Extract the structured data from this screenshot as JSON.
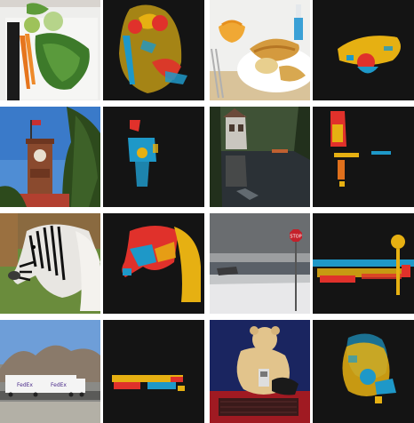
{
  "grid": {
    "rows": 4,
    "columns": 4,
    "pairs_per_row": 2,
    "arrangement": "photo followed by its colored pixel map on dark background"
  },
  "colors": {
    "map_background": "#141414",
    "red": "#e0312b",
    "yellow": "#e6b012",
    "blue": "#1e98c8",
    "orange": "#e0701c"
  },
  "panels": [
    {
      "id": "vegetables-photo",
      "type": "photo",
      "text": ""
    },
    {
      "id": "vegetables-map",
      "type": "map"
    },
    {
      "id": "sandwich-plate-photo",
      "type": "photo",
      "text": ""
    },
    {
      "id": "sandwich-plate-map",
      "type": "map"
    },
    {
      "id": "clock-tower-photo",
      "type": "photo",
      "text": ""
    },
    {
      "id": "clock-tower-map",
      "type": "map"
    },
    {
      "id": "lake-house-photo",
      "type": "photo",
      "text": ""
    },
    {
      "id": "lake-house-map",
      "type": "map"
    },
    {
      "id": "zebra-photo",
      "type": "photo",
      "text": ""
    },
    {
      "id": "zebra-map",
      "type": "map"
    },
    {
      "id": "stop-sign-photo",
      "type": "photo",
      "text": "STOP"
    },
    {
      "id": "stop-sign-map",
      "type": "map"
    },
    {
      "id": "truck-photo",
      "type": "photo",
      "text": "FedEx"
    },
    {
      "id": "truck-map",
      "type": "map"
    },
    {
      "id": "teddy-bear-photo",
      "type": "photo",
      "text": ""
    },
    {
      "id": "teddy-bear-map",
      "type": "map"
    }
  ]
}
